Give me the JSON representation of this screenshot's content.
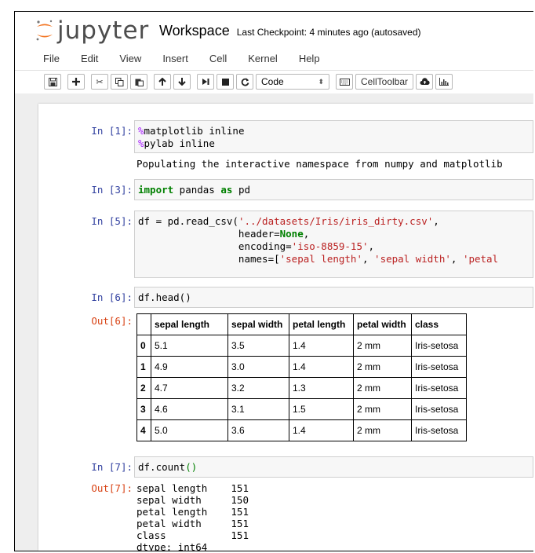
{
  "header": {
    "logo_text": "jupyter",
    "notebook_name": "Workspace",
    "checkpoint": "Last Checkpoint: 4 minutes ago (autosaved)"
  },
  "menu": [
    "File",
    "Edit",
    "View",
    "Insert",
    "Cell",
    "Kernel",
    "Help"
  ],
  "toolbar": {
    "cell_type": "Code",
    "celltoolbar_label": "CellToolbar"
  },
  "cells": {
    "c1": {
      "prompt": "In [1]:",
      "line1_magic": "%",
      "line1_rest": "matplotlib inline",
      "line2_magic": "%",
      "line2_rest": "pylab inline",
      "output": "Populating the interactive namespace from numpy and matplotlib"
    },
    "c3": {
      "prompt": "In [3]:",
      "kw_import": "import",
      "mod": " pandas ",
      "kw_as": "as",
      "alias": " pd"
    },
    "c5": {
      "prompt": "In [5]:",
      "l1_a": "df = pd.read_csv(",
      "l1_str": "'../datasets/Iris/iris_dirty.csv'",
      "l1_b": ",",
      "l2_indent": "                 header=",
      "l2_val": "None",
      "l2_b": ",",
      "l3_indent": "                 encoding=",
      "l3_str": "'iso-8859-15'",
      "l3_b": ",",
      "l4_indent": "                 names=[",
      "l4_s1": "'sepal length'",
      "l4_c1": ", ",
      "l4_s2": "'sepal width'",
      "l4_c2": ", ",
      "l4_s3": "'petal"
    },
    "c6": {
      "prompt": "In [6]:",
      "code": "df.head()",
      "out_prompt": "Out[6]:",
      "columns": [
        "",
        "sepal length",
        "sepal width",
        "petal length",
        "petal width",
        "class"
      ],
      "rows": [
        [
          "0",
          "5.1",
          "3.5",
          "1.4",
          "2 mm",
          "Iris-setosa"
        ],
        [
          "1",
          "4.9",
          "3.0",
          "1.4",
          "2 mm",
          "Iris-setosa"
        ],
        [
          "2",
          "4.7",
          "3.2",
          "1.3",
          "2 mm",
          "Iris-setosa"
        ],
        [
          "3",
          "4.6",
          "3.1",
          "1.5",
          "2 mm",
          "Iris-setosa"
        ],
        [
          "4",
          "5.0",
          "3.6",
          "1.4",
          "2 mm",
          "Iris-setosa"
        ]
      ]
    },
    "c7": {
      "prompt": "In [7]:",
      "code_a": "df.count",
      "code_paren": "()",
      "out_prompt": "Out[7]:",
      "output": "sepal length    151\nsepal width     150\npetal length    151\npetal width     151\nclass           151\ndtype: int64"
    }
  }
}
